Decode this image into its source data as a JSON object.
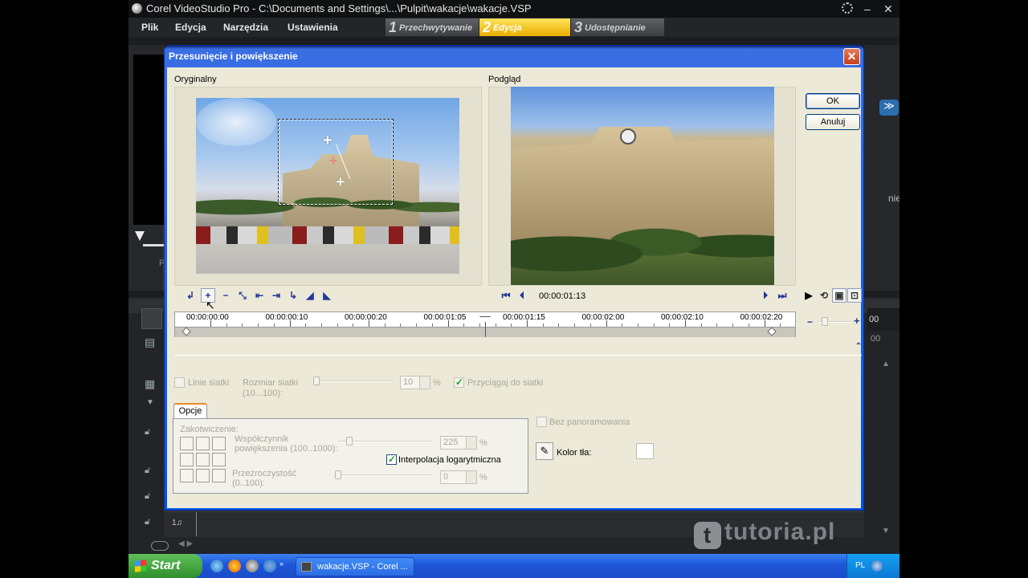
{
  "app": {
    "title": "Corel VideoStudio Pro - C:\\Documents and Settings\\...\\Pulpit\\wakacje\\wakacje.VSP"
  },
  "menu": [
    "Plik",
    "Edycja",
    "Narzędzia",
    "Ustawienia"
  ],
  "steps": [
    {
      "num": "1",
      "label": "Przechwytywanie"
    },
    {
      "num": "2",
      "label": "Edycja"
    },
    {
      "num": "3",
      "label": "Udostępnianie"
    }
  ],
  "background_fragments": {
    "right_text": "nie",
    "left_text": "P",
    "timecode_right": "00",
    "timecode_right2": "00"
  },
  "dialog": {
    "title": "Przesunięcie i powiększenie",
    "close": "✕",
    "original_label": "Oryginalny",
    "preview_label": "Podgląd",
    "ok": "OK",
    "cancel": "Anuluj",
    "timecode": "00:00:01:13",
    "timeline_labels": [
      "00:00:00:00",
      "00:00:00:10",
      "00:00:00:20",
      "00:00:01:05",
      "00:00:01:15",
      "00:00:02:00",
      "00:00:02:10",
      "00:00:02:20"
    ],
    "playhead_fraction": 0.5,
    "grid": {
      "lines_label": "Linie siatki",
      "size_label": "Rozmiar siatki",
      "size_range": "(10...100):",
      "size_value": "10",
      "pct": "%",
      "snap_label": "Przyciągaj do siatki"
    },
    "options": {
      "tab": "Opcje",
      "anchor_label": "Zakotwiczenie:",
      "zoom_label": "Współczynnik",
      "zoom_label2": "powiększenia (100..1000):",
      "zoom_value": "225",
      "log_interp": "Interpolacja logarytmiczna",
      "opacity_label": "Przezroczystość",
      "opacity_range": "(0..100):",
      "opacity_value": "0",
      "pct": "%"
    },
    "no_pan": "Bez panoramowania",
    "bg_color_label": "Kolor tła:",
    "bg_color": "#ffffff"
  },
  "taskbar": {
    "start": "Start",
    "task": "wakacje.VSP - Corel ...",
    "lang": "PL"
  },
  "watermark": {
    "text": "tutoria.pl",
    "logo": "t"
  }
}
